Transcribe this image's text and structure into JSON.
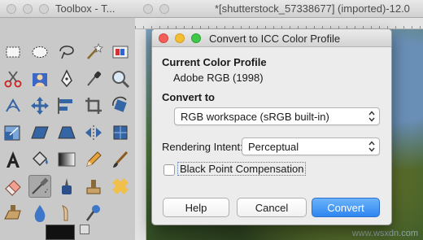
{
  "toolbox": {
    "title": "Toolbox - T..."
  },
  "image_window": {
    "title": "*[shutterstock_57338677] (imported)-12.0"
  },
  "dialog": {
    "title": "Convert to ICC Color Profile",
    "current_profile_heading": "Current Color Profile",
    "current_profile_value": "Adobe RGB (1998)",
    "convert_to_heading": "Convert to",
    "convert_to_value": "RGB workspace (sRGB built-in)",
    "rendering_intent_label": "Rendering Intent:",
    "rendering_intent_value": "Perceptual",
    "black_point_label": "Black Point Compensation",
    "black_point_checked": false,
    "buttons": {
      "help": "Help",
      "cancel": "Cancel",
      "convert": "Convert"
    }
  },
  "colors": {
    "primary_button": "#2e86f0",
    "close_dot": "#f25f56",
    "minimize_dot": "#f5be32",
    "zoom_dot": "#3fc74a"
  },
  "watermark": "www.wsxdn.com",
  "tools": [
    "rect-select-icon",
    "ellipse-select-icon",
    "lasso-icon",
    "fuzzy-select-icon",
    "color-select-icon",
    "scissors-icon",
    "foreground-select-icon",
    "paths-icon",
    "color-picker-icon",
    "zoom-icon",
    "measure-icon",
    "move-icon",
    "align-icon",
    "crop-icon",
    "rotate-icon",
    "scale-icon",
    "shear-icon",
    "perspective-icon",
    "flip-icon",
    "cage-icon",
    "text-icon",
    "bucket-fill-icon",
    "blend-icon",
    "pencil-icon",
    "paintbrush-icon",
    "eraser-icon",
    "airbrush-icon",
    "ink-icon",
    "clone-icon",
    "heal-icon",
    "perspective-clone-icon",
    "blur-icon",
    "smudge-icon",
    "dodge-burn-icon"
  ]
}
